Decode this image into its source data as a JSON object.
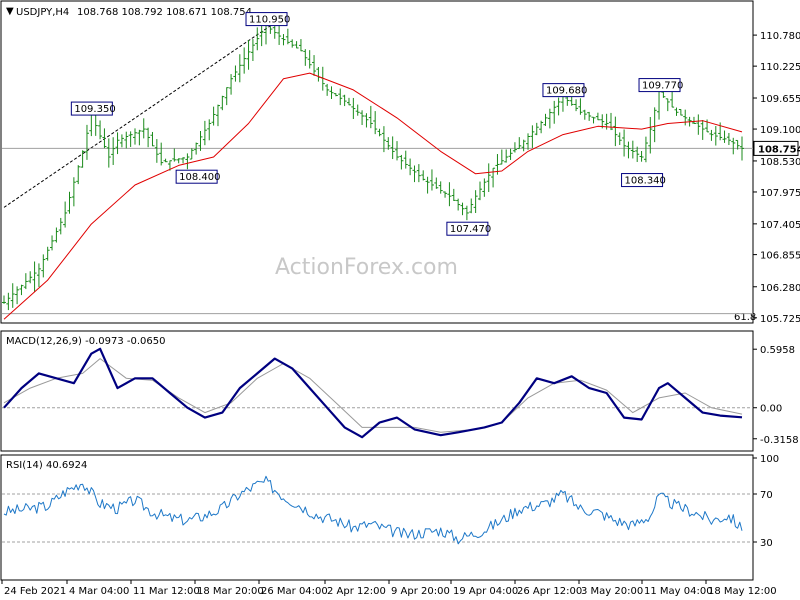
{
  "header": {
    "symbol": "USDJPY,H4",
    "ohlc": "108.768 108.792 108.671 108.754",
    "macd_label": "MACD(12,26,9) -0.0973 -0.0650",
    "rsi_label": "RSI(14) 40.6924",
    "watermark": "ActionForex.com",
    "fib_label": "61.8"
  },
  "colors": {
    "price_bar": "#1a8a1a",
    "ma": "#e00000",
    "macd": "#000080",
    "signal": "#9a9a9a",
    "rsi": "#1e78c8",
    "label_border": "#000080"
  },
  "chart_data": [
    {
      "type": "ohlc",
      "title": "USDJPY,H4",
      "x_ticks": [
        "24 Feb 2021",
        "4 Mar 04:00",
        "11 Mar 12:00",
        "18 Mar 20:00",
        "26 Mar 04:00",
        "2 Apr 12:00",
        "9 Apr 20:00",
        "19 Apr 04:00",
        "26 Apr 12:00",
        "3 May 20:00",
        "11 May 04:00",
        "18 May 12:00"
      ],
      "y_ticks": [
        "110.780",
        "110.225",
        "109.655",
        "109.100",
        "108.530",
        "107.975",
        "107.405",
        "106.855",
        "106.280",
        "105.725"
      ],
      "ylim": [
        105.725,
        111.1
      ],
      "current_price": "108.754",
      "close_path": [
        [
          0,
          106.0
        ],
        [
          8,
          106.6
        ],
        [
          14,
          107.6
        ],
        [
          18,
          108.7
        ],
        [
          20,
          109.35
        ],
        [
          24,
          108.6
        ],
        [
          26,
          108.9
        ],
        [
          32,
          109.1
        ],
        [
          36,
          108.5
        ],
        [
          42,
          108.6
        ],
        [
          47,
          109.2
        ],
        [
          52,
          110.0
        ],
        [
          57,
          110.6
        ],
        [
          60,
          110.95
        ],
        [
          64,
          110.7
        ],
        [
          68,
          110.5
        ],
        [
          70,
          110.25
        ],
        [
          74,
          109.8
        ],
        [
          78,
          109.6
        ],
        [
          84,
          109.2
        ],
        [
          90,
          108.6
        ],
        [
          96,
          108.2
        ],
        [
          102,
          107.9
        ],
        [
          106,
          107.6
        ],
        [
          108,
          107.9
        ],
        [
          112,
          108.4
        ],
        [
          118,
          108.8
        ],
        [
          124,
          109.3
        ],
        [
          128,
          109.68
        ],
        [
          132,
          109.4
        ],
        [
          138,
          109.2
        ],
        [
          142,
          108.8
        ],
        [
          146,
          108.6
        ],
        [
          148,
          109.1
        ],
        [
          150,
          109.77
        ],
        [
          154,
          109.4
        ],
        [
          158,
          109.2
        ],
        [
          162,
          109.0
        ],
        [
          166,
          108.9
        ],
        [
          169,
          108.754
        ]
      ],
      "ma_path": [
        [
          0,
          105.7
        ],
        [
          10,
          106.4
        ],
        [
          20,
          107.4
        ],
        [
          30,
          108.1
        ],
        [
          40,
          108.45
        ],
        [
          48,
          108.6
        ],
        [
          56,
          109.2
        ],
        [
          64,
          110.0
        ],
        [
          70,
          110.1
        ],
        [
          80,
          109.8
        ],
        [
          90,
          109.3
        ],
        [
          100,
          108.7
        ],
        [
          108,
          108.3
        ],
        [
          114,
          108.35
        ],
        [
          120,
          108.7
        ],
        [
          128,
          109.0
        ],
        [
          136,
          109.15
        ],
        [
          146,
          109.1
        ],
        [
          152,
          109.2
        ],
        [
          160,
          109.25
        ],
        [
          169,
          109.05
        ]
      ],
      "annotations": [
        {
          "label": "110.950",
          "i": 60,
          "v": 110.95
        },
        {
          "label": "109.350",
          "i": 20,
          "v": 109.35
        },
        {
          "label": "108.400",
          "i": 44,
          "v": 108.4
        },
        {
          "label": "107.470",
          "i": 106,
          "v": 107.47
        },
        {
          "label": "109.680",
          "i": 128,
          "v": 109.68
        },
        {
          "label": "109.770",
          "i": 150,
          "v": 109.77
        },
        {
          "label": "108.340",
          "i": 146,
          "v": 108.34
        }
      ],
      "trendline": [
        [
          0,
          107.7
        ],
        [
          62,
          111.0
        ]
      ],
      "fib_618": 105.8,
      "hline": 108.754
    },
    {
      "type": "line",
      "title": "MACD(12,26,9)",
      "y_ticks": [
        "0.5958",
        "0.00",
        "-0.3158"
      ],
      "ylim": [
        -0.42,
        0.72
      ],
      "macd_path": [
        [
          0,
          0.0
        ],
        [
          4,
          0.2
        ],
        [
          8,
          0.35
        ],
        [
          12,
          0.3
        ],
        [
          16,
          0.25
        ],
        [
          20,
          0.55
        ],
        [
          22,
          0.6
        ],
        [
          26,
          0.2
        ],
        [
          30,
          0.3
        ],
        [
          34,
          0.3
        ],
        [
          38,
          0.15
        ],
        [
          42,
          0.0
        ],
        [
          46,
          -0.1
        ],
        [
          50,
          -0.05
        ],
        [
          54,
          0.2
        ],
        [
          58,
          0.35
        ],
        [
          62,
          0.5
        ],
        [
          66,
          0.4
        ],
        [
          70,
          0.2
        ],
        [
          74,
          0.0
        ],
        [
          78,
          -0.2
        ],
        [
          82,
          -0.3
        ],
        [
          86,
          -0.15
        ],
        [
          90,
          -0.1
        ],
        [
          94,
          -0.22
        ],
        [
          100,
          -0.28
        ],
        [
          104,
          -0.25
        ],
        [
          110,
          -0.2
        ],
        [
          114,
          -0.15
        ],
        [
          118,
          0.05
        ],
        [
          122,
          0.3
        ],
        [
          126,
          0.25
        ],
        [
          130,
          0.32
        ],
        [
          134,
          0.2
        ],
        [
          138,
          0.15
        ],
        [
          142,
          -0.1
        ],
        [
          146,
          -0.12
        ],
        [
          150,
          0.2
        ],
        [
          152,
          0.25
        ],
        [
          156,
          0.1
        ],
        [
          160,
          -0.05
        ],
        [
          164,
          -0.08
        ],
        [
          169,
          -0.0973
        ]
      ],
      "signal_path": [
        [
          0,
          0.05
        ],
        [
          6,
          0.2
        ],
        [
          12,
          0.3
        ],
        [
          18,
          0.35
        ],
        [
          22,
          0.5
        ],
        [
          28,
          0.3
        ],
        [
          34,
          0.28
        ],
        [
          40,
          0.1
        ],
        [
          46,
          -0.05
        ],
        [
          52,
          0.05
        ],
        [
          58,
          0.3
        ],
        [
          64,
          0.45
        ],
        [
          70,
          0.3
        ],
        [
          76,
          0.05
        ],
        [
          82,
          -0.2
        ],
        [
          88,
          -0.2
        ],
        [
          94,
          -0.2
        ],
        [
          100,
          -0.25
        ],
        [
          108,
          -0.22
        ],
        [
          114,
          -0.15
        ],
        [
          120,
          0.1
        ],
        [
          126,
          0.25
        ],
        [
          132,
          0.28
        ],
        [
          138,
          0.18
        ],
        [
          144,
          -0.05
        ],
        [
          150,
          0.1
        ],
        [
          156,
          0.15
        ],
        [
          162,
          0.0
        ],
        [
          169,
          -0.065
        ]
      ]
    },
    {
      "type": "line",
      "title": "RSI(14)",
      "y_ticks": [
        "100",
        "70",
        "30"
      ],
      "ylim": [
        0,
        100
      ],
      "rsi_path": [
        [
          0,
          55
        ],
        [
          6,
          58
        ],
        [
          10,
          60
        ],
        [
          14,
          72
        ],
        [
          18,
          80
        ],
        [
          22,
          62
        ],
        [
          26,
          58
        ],
        [
          30,
          65
        ],
        [
          34,
          55
        ],
        [
          38,
          50
        ],
        [
          42,
          48
        ],
        [
          46,
          52
        ],
        [
          50,
          58
        ],
        [
          54,
          70
        ],
        [
          58,
          78
        ],
        [
          60,
          80
        ],
        [
          64,
          68
        ],
        [
          68,
          60
        ],
        [
          72,
          52
        ],
        [
          76,
          48
        ],
        [
          80,
          42
        ],
        [
          84,
          45
        ],
        [
          88,
          40
        ],
        [
          92,
          36
        ],
        [
          96,
          38
        ],
        [
          100,
          40
        ],
        [
          104,
          33
        ],
        [
          106,
          35
        ],
        [
          110,
          40
        ],
        [
          114,
          48
        ],
        [
          118,
          58
        ],
        [
          124,
          62
        ],
        [
          128,
          70
        ],
        [
          132,
          58
        ],
        [
          136,
          55
        ],
        [
          140,
          48
        ],
        [
          144,
          44
        ],
        [
          148,
          52
        ],
        [
          150,
          68
        ],
        [
          154,
          60
        ],
        [
          158,
          55
        ],
        [
          162,
          48
        ],
        [
          166,
          52
        ],
        [
          169,
          40.69
        ]
      ]
    }
  ]
}
